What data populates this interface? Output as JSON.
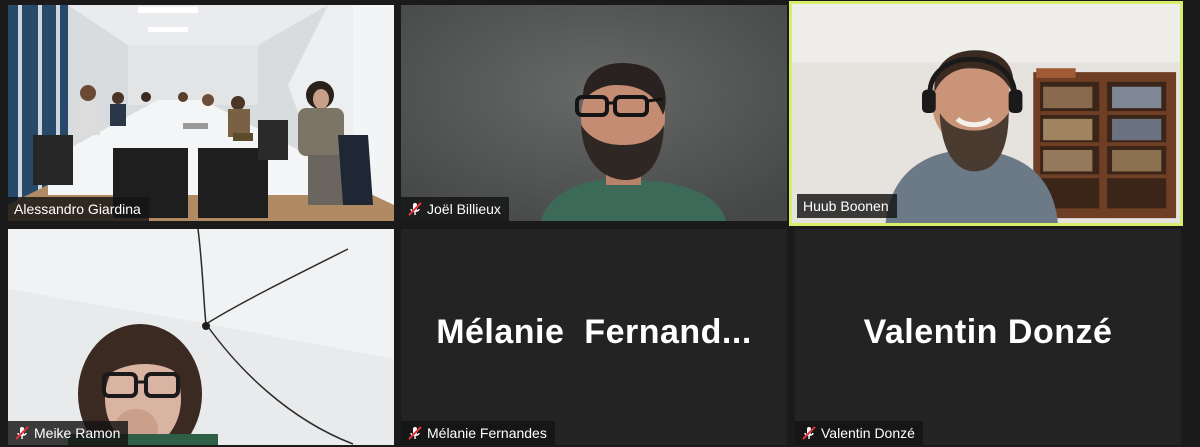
{
  "participants": [
    {
      "name": "Alessandro Giardina",
      "muted": false,
      "video": "conference-room"
    },
    {
      "name": "Joël Billieux",
      "muted": true,
      "video": "man-glasses-beard"
    },
    {
      "name": "Huub Boonen",
      "muted": false,
      "video": "man-headset-bookshelf",
      "active_speaker": true
    },
    {
      "name": "Meike Ramon",
      "muted": true,
      "video": "woman-glasses"
    },
    {
      "name": "Mélanie Fernandes",
      "muted": true,
      "video": "off",
      "display_label": "Mélanie  Fernand..."
    },
    {
      "name": "Valentin Donzé",
      "muted": true,
      "video": "off",
      "display_label": "Valentin Donzé"
    }
  ],
  "colors": {
    "background": "#1a1a1a",
    "tile": "#232323",
    "active_speaker_border": "#d6ee6a",
    "mute_icon": "#e0343a"
  },
  "icons": {
    "mute": "microphone-muted-icon"
  }
}
